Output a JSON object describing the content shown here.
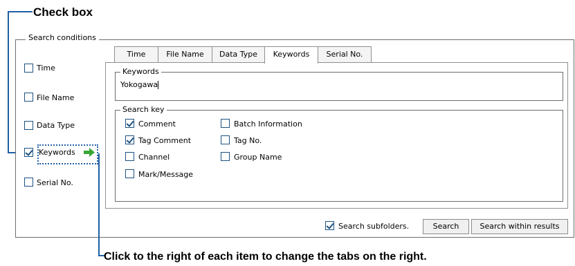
{
  "callouts": {
    "check_box": "Check box",
    "bottom_note": "Click to the right of each item to change the tabs on the right."
  },
  "search_conditions": {
    "title": "Search conditions",
    "items": [
      {
        "label": "Time",
        "checked": false
      },
      {
        "label": "File Name",
        "checked": false
      },
      {
        "label": "Data Type",
        "checked": false
      },
      {
        "label": "Keywords",
        "checked": true
      },
      {
        "label": "Serial No.",
        "checked": false
      }
    ]
  },
  "tabs": [
    {
      "label": "Time",
      "active": false
    },
    {
      "label": "File Name",
      "active": false
    },
    {
      "label": "Data Type",
      "active": false
    },
    {
      "label": "Keywords",
      "active": true
    },
    {
      "label": "Serial No.",
      "active": false
    }
  ],
  "keywords_panel": {
    "keywords_label": "Keywords",
    "keywords_value": "Yokogawa",
    "search_key_label": "Search key",
    "search_keys": [
      {
        "label": "Comment",
        "checked": true
      },
      {
        "label": "Tag Comment",
        "checked": true
      },
      {
        "label": "Channel",
        "checked": false
      },
      {
        "label": "Mark/Message",
        "checked": false
      },
      {
        "label": "Batch Information",
        "checked": false
      },
      {
        "label": "Tag No.",
        "checked": false
      },
      {
        "label": "Group Name",
        "checked": false
      }
    ]
  },
  "footer": {
    "subfolders_label": "Search subfolders.",
    "subfolders_checked": true,
    "search_button": "Search",
    "search_within_button": "Search within results"
  },
  "colors": {
    "callout_line": "#1f5fa6",
    "arrow_icon": "#3aa635",
    "checkbox_border": "#1c5180"
  }
}
